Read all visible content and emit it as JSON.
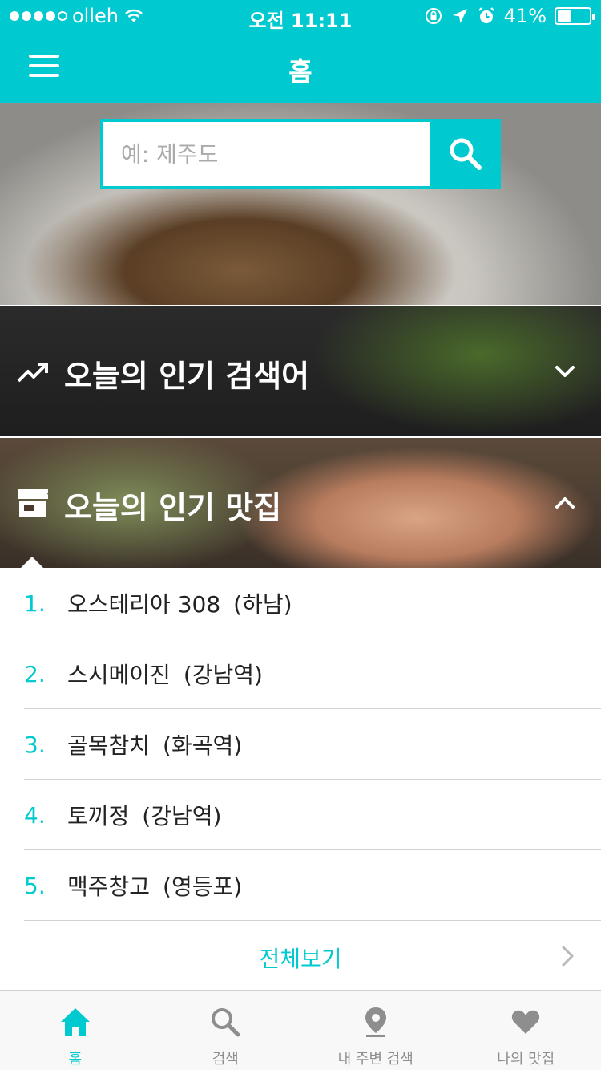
{
  "status_bar": {
    "carrier": "olleh",
    "time": "오전 11:11",
    "battery_percent_label": "41%",
    "battery_level": 0.41
  },
  "nav": {
    "title": "홈"
  },
  "search": {
    "placeholder": "예: 제주도"
  },
  "sections": [
    {
      "title": "오늘의 인기 검색어",
      "icon": "trending-up-icon",
      "expanded": false
    },
    {
      "title": "오늘의 인기 맛집",
      "icon": "store-icon",
      "expanded": true
    }
  ],
  "restaurants": [
    {
      "rank": "1.",
      "name": "오스테리아 308",
      "area": "(하남)"
    },
    {
      "rank": "2.",
      "name": "스시메이진",
      "area": "(강남역)"
    },
    {
      "rank": "3.",
      "name": "골목참치",
      "area": "(화곡역)"
    },
    {
      "rank": "4.",
      "name": "토끼정",
      "area": "(강남역)"
    },
    {
      "rank": "5.",
      "name": "맥주창고",
      "area": "(영등포)"
    }
  ],
  "view_all_label": "전체보기",
  "tabs": [
    {
      "label": "홈",
      "icon": "home-icon",
      "active": true
    },
    {
      "label": "검색",
      "icon": "search-icon",
      "active": false
    },
    {
      "label": "내 주변 검색",
      "icon": "location-pin-icon",
      "active": false
    },
    {
      "label": "나의 맛집",
      "icon": "heart-icon",
      "active": false
    }
  ],
  "colors": {
    "accent": "#00c9cf",
    "tab_inactive": "#8e8e8e",
    "divider": "#d2d2d2"
  }
}
